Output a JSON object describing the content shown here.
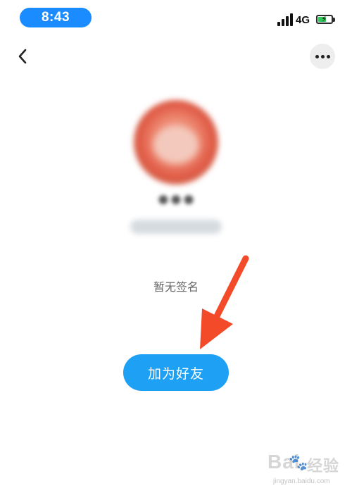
{
  "status_bar": {
    "time": "8:43",
    "network": "4G"
  },
  "nav": {
    "back_icon": "chevron-left-icon",
    "more_icon": "ellipsis-icon"
  },
  "profile": {
    "signature": "暂无签名",
    "add_friend_label": "加为好友"
  },
  "annotation": {
    "arrow_color": "#f34a2a"
  },
  "colors": {
    "accent": "#1ea0f5",
    "status_pill": "#1a8cff"
  },
  "watermark": {
    "brand": "Bai",
    "brand_suffix": "经验",
    "url": "jingyan.baidu.com"
  }
}
